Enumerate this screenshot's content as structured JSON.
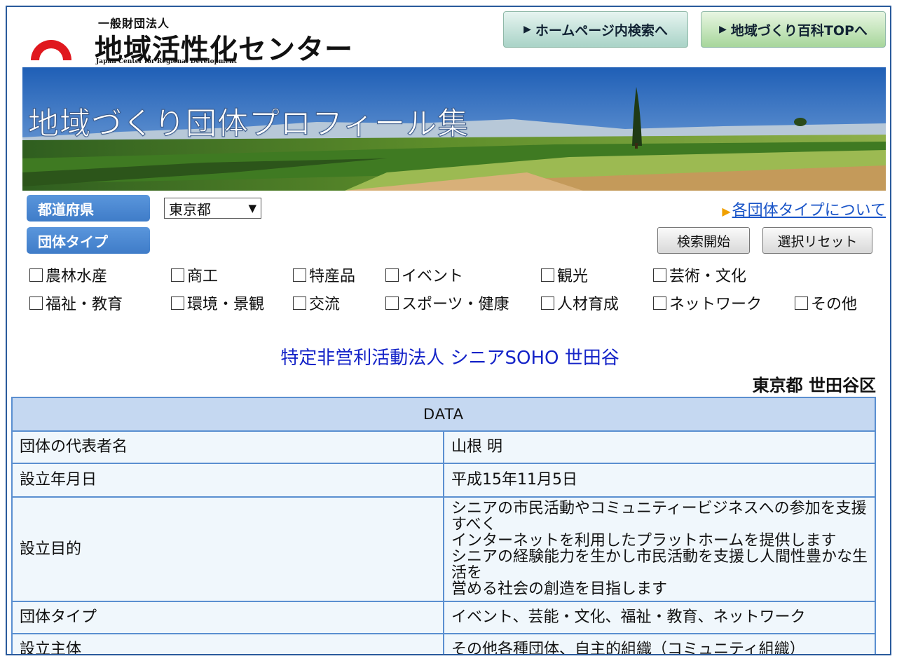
{
  "header": {
    "org_small": "一般財団法人",
    "org_name": "地域活性化センター",
    "org_en": "Japan Center for Regional Development",
    "nav_search_label": "ホームページ内検索へ",
    "nav_top_label": "地域づくり百科TOPへ",
    "logo_color": "#e0181e"
  },
  "banner": {
    "title": "地域づくり団体プロフィール集"
  },
  "filters": {
    "pref_tag": "都道府県",
    "pref_selected": "東京都",
    "type_tag": "団体タイプ",
    "type_link": "各団体タイプについて",
    "search_button": "検索開始",
    "reset_button": "選択リセット",
    "types_row1": [
      "農林水産",
      "商工",
      "特産品",
      "イベント",
      "観光",
      "芸術・文化"
    ],
    "types_row2": [
      "福祉・教育",
      "環境・景観",
      "交流",
      "スポーツ・健康",
      "人材育成",
      "ネットワーク",
      "その他"
    ]
  },
  "org": {
    "title": "特定非営利活動法人 シニアSOHO 世田谷",
    "location": "東京都 世田谷区"
  },
  "table": {
    "header": "DATA",
    "rows": [
      {
        "key": "団体の代表者名",
        "value": "山根 明"
      },
      {
        "key": "設立年月日",
        "value": "平成15年11月5日"
      },
      {
        "key": "設立目的",
        "lines": [
          "シニアの市民活動やコミュニティービジネスへの参加を支援すべく",
          "インターネットを利用したプラットホームを提供します",
          "シニアの経験能力を生かし市民活動を支援し人間性豊かな生活を",
          "営める社会の創造を目指します"
        ]
      },
      {
        "key": "団体タイプ",
        "value": "イベント、芸能・文化、福祉・教育、ネットワーク"
      },
      {
        "key": "設立主体",
        "value": "その他各種団体、自主的組織（コミュニティ組織）"
      }
    ]
  }
}
